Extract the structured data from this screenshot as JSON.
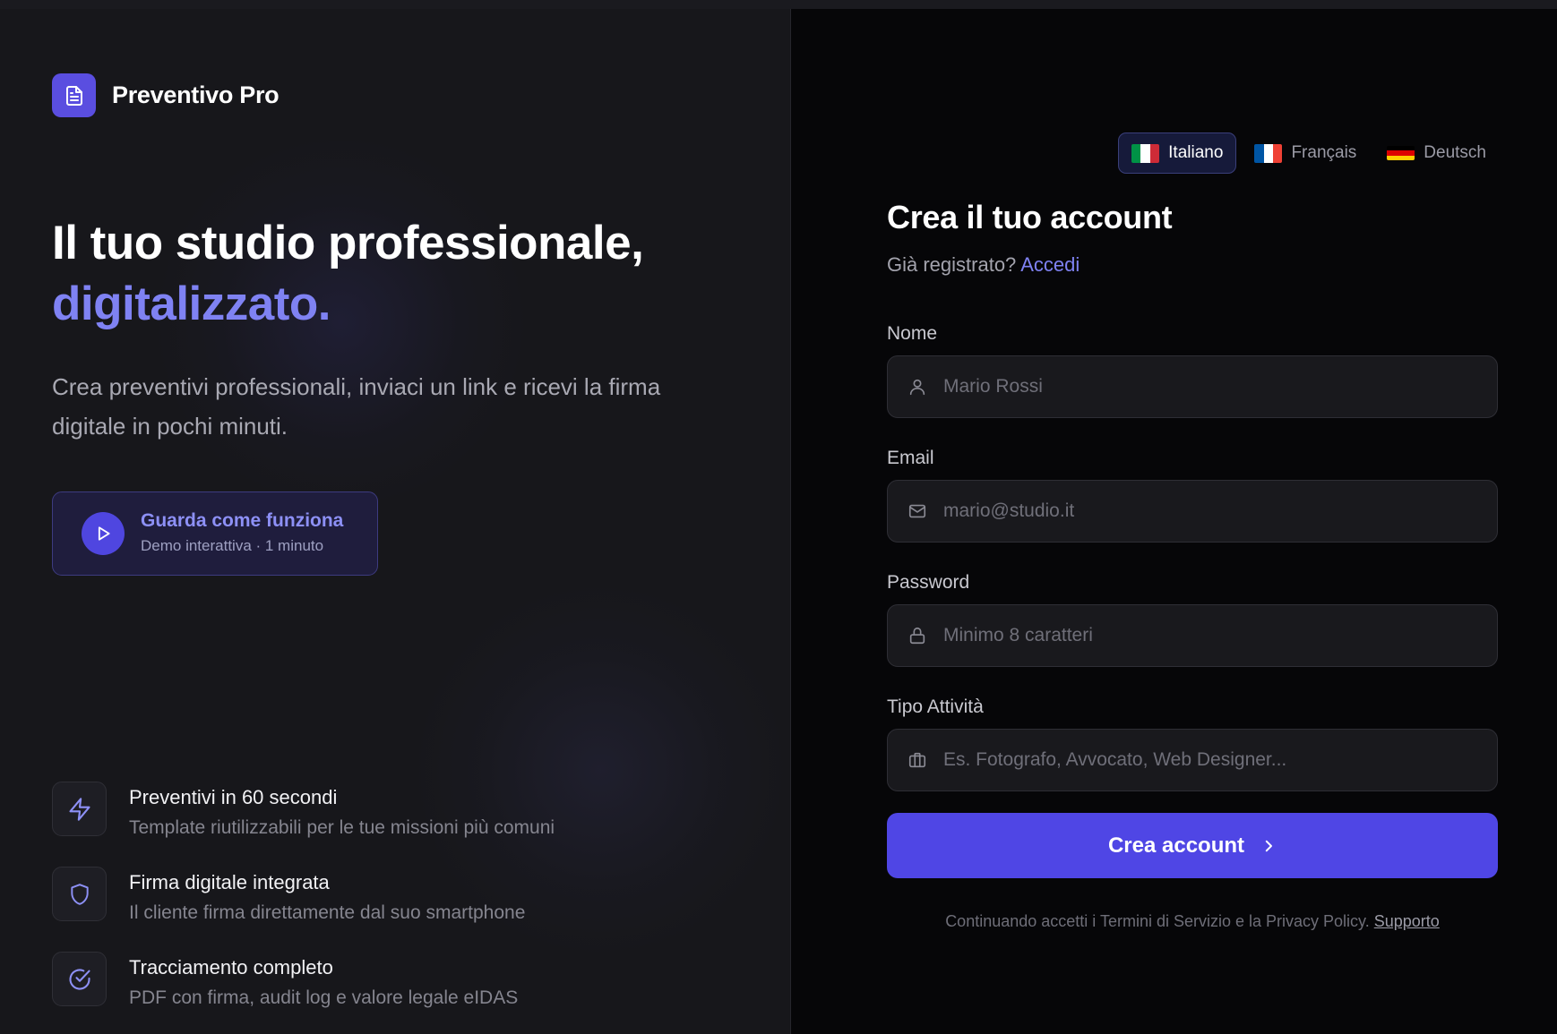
{
  "brand": {
    "name": "Preventivo Pro",
    "color": "#5a4ee0",
    "icon": "document-icon"
  },
  "hero": {
    "headline": "Il tuo studio professionale,",
    "headline_accent": "digitalizzato.",
    "subtitle": "Crea preventivi professionali, inviaci un link e ricevi la firma digitale in pochi minuti."
  },
  "demo": {
    "title": "Guarda come funziona",
    "subtitle": "Demo interattiva · 1 minuto",
    "icon": "play-icon"
  },
  "features": [
    {
      "icon": "lightning-icon",
      "title": "Preventivi in 60 secondi",
      "description": "Template riutilizzabili per le tue missioni più comuni"
    },
    {
      "icon": "shield-icon",
      "title": "Firma digitale integrata",
      "description": "Il cliente firma direttamente dal suo smartphone"
    },
    {
      "icon": "check-circle-icon",
      "title": "Tracciamento completo",
      "description": "PDF con firma, audit log e valore legale eIDAS"
    }
  ],
  "languages": [
    {
      "label": "Italiano",
      "active": true,
      "flag": [
        "#009246",
        "#ffffff",
        "#ce2b37"
      ]
    },
    {
      "label": "Français",
      "active": false,
      "flag": [
        "#0055a4",
        "#ffffff",
        "#ef4135"
      ]
    },
    {
      "label": "Deutsch",
      "active": false,
      "flag": [
        "#000000",
        "#dd0000",
        "#ffce00"
      ]
    }
  ],
  "form": {
    "title": "Crea il tuo account",
    "login_prompt": "Già registrato?",
    "login_link": "Accedi",
    "fields": {
      "name": {
        "label": "Nome",
        "value": "",
        "placeholder": "Mario Rossi",
        "icon": "user-icon"
      },
      "email": {
        "label": "Email",
        "value": "",
        "placeholder": "mario@studio.it",
        "icon": "mail-icon"
      },
      "password": {
        "label": "Password",
        "value": "",
        "placeholder": "Minimo 8 caratteri",
        "icon": "lock-icon"
      },
      "activity": {
        "label": "Tipo Attività",
        "value": "",
        "placeholder": "Es. Fotografo, Avvocato, Web Designer...",
        "icon": "briefcase-icon"
      }
    },
    "submit_label": "Crea account",
    "accent_color": "#4f46e5",
    "legal_text": "Continuando accetti i Termini di Servizio e la Privacy Policy.",
    "support_link": "Supporto"
  }
}
